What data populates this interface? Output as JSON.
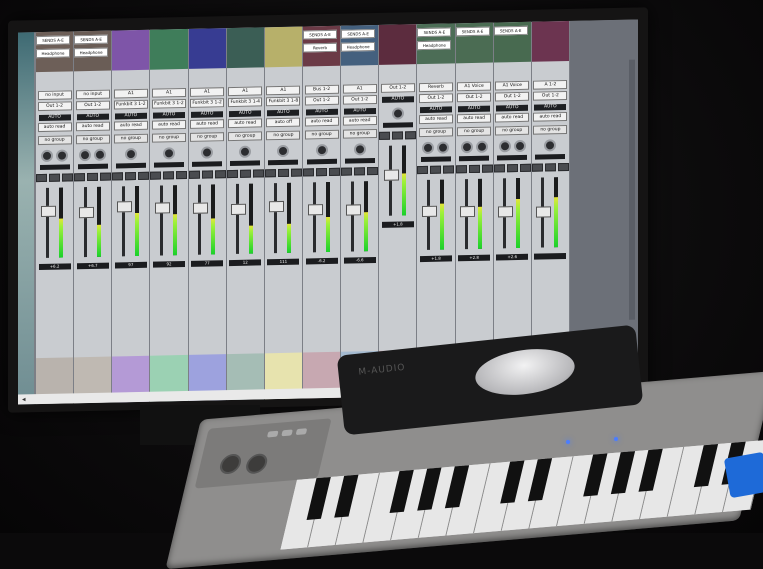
{
  "app": {
    "name": "Pro Tools Mix Window"
  },
  "channels": [
    {
      "send": "SENDS A-E",
      "send2": "Headphone",
      "io_in": "no input",
      "io_out": "Out 1-2",
      "auto": "AUTO",
      "auto_mode": "auto read",
      "group": "no group",
      "vol": "+6.2",
      "top": "#6d5f58",
      "block": "#b9b3ad",
      "meter": 0.55,
      "fader": 0.3
    },
    {
      "send": "SENDS A-E",
      "send2": "Headphone",
      "io_in": "no input",
      "io_out": "Out 1-2",
      "auto": "AUTO",
      "auto_mode": "auto read",
      "group": "no group",
      "vol": "+6.7",
      "top": "#6a5d56",
      "block": "#bfb9b2",
      "meter": 0.45,
      "fader": 0.33
    },
    {
      "send": "",
      "send2": "",
      "io_in": "A1",
      "io_out": "Funkbit 3 1-2",
      "auto": "AUTO",
      "auto_mode": "auto read",
      "group": "no group",
      "vol": "97",
      "top": "#7e55a8",
      "block": "#b49ad6",
      "meter": 0.62,
      "fader": 0.25
    },
    {
      "send": "",
      "send2": "",
      "io_in": "A1",
      "io_out": "Funkbit 3 1-2",
      "auto": "AUTO",
      "auto_mode": "auto read",
      "group": "no group",
      "vol": "92",
      "top": "#3f7d5a",
      "block": "#9bd1b3",
      "meter": 0.58,
      "fader": 0.28
    },
    {
      "send": "",
      "send2": "",
      "io_in": "A1",
      "io_out": "Funkbit 3 1-2",
      "auto": "AUTO",
      "auto_mode": "auto read",
      "group": "no group",
      "vol": "77",
      "top": "#373c92",
      "block": "#9da2de",
      "meter": 0.52,
      "fader": 0.3
    },
    {
      "send": "",
      "send2": "",
      "io_in": "A1",
      "io_out": "Funkbit 3 1-4",
      "auto": "AUTO",
      "auto_mode": "auto read",
      "group": "no group",
      "vol": "12",
      "top": "#3b5e55",
      "block": "#a5bdb5",
      "meter": 0.4,
      "fader": 0.32
    },
    {
      "send": "",
      "send2": "",
      "io_in": "A1",
      "io_out": "Funkbit 3 1-8",
      "auto": "AUTO",
      "auto_mode": "auto off",
      "group": "no group",
      "vol": "111",
      "top": "#b7b06a",
      "block": "#e7e3ae",
      "meter": 0.42,
      "fader": 0.3
    },
    {
      "send": "SENDS A-E",
      "send2": "Reverb",
      "io_in": "Bus 1-2",
      "io_out": "Out 1-2",
      "auto": "AUTO",
      "auto_mode": "auto read",
      "group": "no group",
      "vol": "-6.2",
      "top": "#6b3a46",
      "block": "#c7a8b1",
      "meter": 0.5,
      "fader": 0.36
    },
    {
      "send": "SENDS A-E",
      "send2": "Headphone",
      "io_in": "A1",
      "io_out": "Out 1-2",
      "auto": "AUTO",
      "auto_mode": "auto read",
      "group": "no group",
      "vol": "-6.6",
      "top": "#44607e",
      "block": "#a4bad0",
      "meter": 0.56,
      "fader": 0.38
    },
    {
      "send": "",
      "send2": "",
      "io_in": "Out 1-2",
      "io_out": "",
      "auto": "AUTO",
      "auto_mode": "",
      "group": "",
      "vol": "+1.8",
      "top": "#5c2c3e",
      "block": "#c0a0ad",
      "meter": 0.6,
      "fader": 0.4
    },
    {
      "send": "SENDS A-E",
      "send2": "Headphone",
      "io_in": "Reverb",
      "io_out": "Out 1-2",
      "auto": "AUTO",
      "auto_mode": "auto read",
      "group": "no group",
      "vol": "+1.8",
      "top": "#4c6d56",
      "block": "#b4c8b9",
      "meter": 0.65,
      "fader": 0.42
    },
    {
      "send": "SENDS A-E",
      "send2": "",
      "io_in": "A1 Voice",
      "io_out": "Out 1-2",
      "auto": "AUTO",
      "auto_mode": "auto read",
      "group": "no group",
      "vol": "+2.8",
      "top": "#4b6c53",
      "block": "#b0c5b6",
      "meter": 0.6,
      "fader": 0.44
    },
    {
      "send": "SENDS A-E",
      "send2": "",
      "io_in": "A1 Voice",
      "io_out": "Out 1-2",
      "auto": "AUTO",
      "auto_mode": "auto read",
      "group": "no group",
      "vol": "+2.6",
      "top": "#486a50",
      "block": "#adc2b3",
      "meter": 0.7,
      "fader": 0.46
    },
    {
      "send": "",
      "send2": "",
      "io_in": "A 1-2",
      "io_out": "Out 1-2",
      "auto": "AUTO",
      "auto_mode": "auto read",
      "group": "no group",
      "vol": "",
      "top": "#6c3450",
      "block": "#c8a4b8",
      "meter": 0.72,
      "fader": 0.48
    }
  ],
  "device": {
    "label": "M-AUDIO"
  }
}
